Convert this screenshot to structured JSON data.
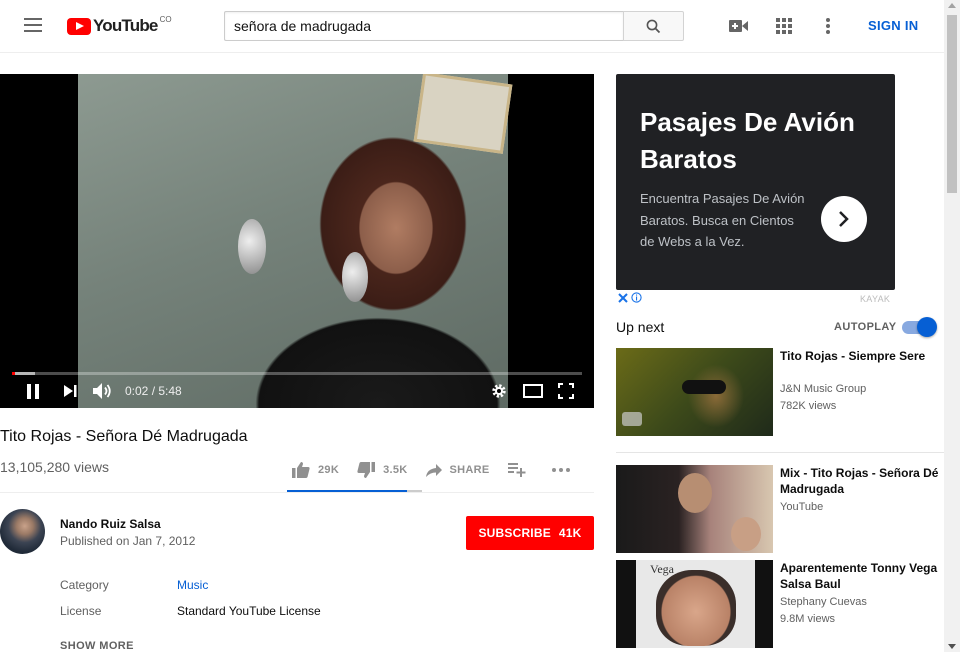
{
  "header": {
    "logo_text": "YouTube",
    "logo_country": "CO",
    "search_value": "señora de madrugada",
    "signin_label": "SIGN IN"
  },
  "player": {
    "time": "0:02 / 5:48",
    "progress_fraction": 0.006,
    "buffer_fraction": 0.04
  },
  "video": {
    "title": "Tito Rojas - Señora Dé Madrugada",
    "views": "13,105,280 views",
    "likes": "29K",
    "dislikes": "3.5K",
    "share_label": "SHARE",
    "like_ratio": 0.89
  },
  "channel": {
    "name": "Nando Ruiz Salsa",
    "published": "Published on Jan 7, 2012",
    "subscribe_label": "SUBSCRIBE",
    "subscriber_count": "41K"
  },
  "meta": {
    "category_label": "Category",
    "category_value": "Music",
    "license_label": "License",
    "license_value": "Standard YouTube License",
    "show_more": "SHOW MORE"
  },
  "ad": {
    "title": "Pasajes De Avión Baratos",
    "body": "Encuentra Pasajes De Avión Baratos. Busca en Cientos de Webs a la Vez.",
    "advertiser": "KAYAK"
  },
  "sidebar": {
    "up_next": "Up next",
    "autoplay": "AUTOPLAY",
    "autoplay_on": true,
    "recommendations": [
      {
        "title": "Tito Rojas - Siempre Sere",
        "channel": "J&N Music Group",
        "views": "782K views"
      },
      {
        "title": "Mix - Tito Rojas - Señora Dé Madrugada",
        "channel": "YouTube",
        "views": ""
      },
      {
        "title": "Aparentemente Tonny Vega Salsa Baul",
        "channel": "Stephany Cuevas",
        "views": "9.8M views",
        "thumb_text": "Vega"
      }
    ]
  },
  "colors": {
    "brand_red": "#ff0000",
    "link_blue": "#065fd4",
    "ad_background": "#202124"
  }
}
